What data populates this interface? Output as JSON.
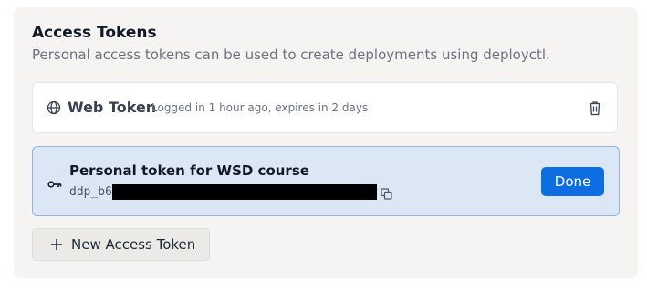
{
  "section": {
    "title": "Access Tokens",
    "description": "Personal access tokens can be used to create deployments using deployctl."
  },
  "tokens": [
    {
      "name": "Web Token",
      "meta": "Logged in 1 hour ago, expires in 2 days",
      "icon": "globe-icon"
    }
  ],
  "new_token": {
    "name": "Personal token for WSD course",
    "token_prefix": "ddp_b6",
    "icon": "key-icon",
    "done_label": "Done"
  },
  "actions": {
    "new_token_label": "New Access Token"
  },
  "colors": {
    "accent": "#0c6ee0",
    "highlight_bg": "#dce7f5",
    "highlight_border": "#8bb4e8",
    "panel_bg": "#f5f4f2"
  }
}
